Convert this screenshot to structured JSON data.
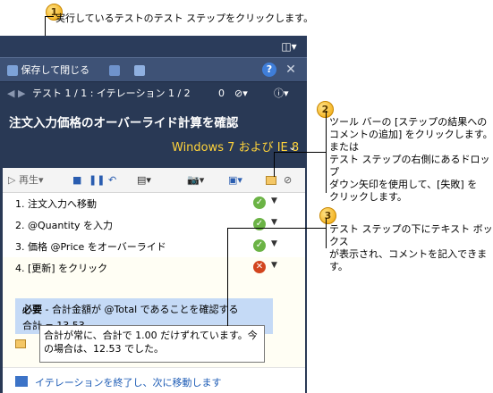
{
  "callouts": [
    {
      "num": "1",
      "text": "実行しているテストのテスト ステップをクリックします。"
    },
    {
      "num": "2",
      "lines": [
        "ツール バーの [ステップの結果への",
        "コメントの追加] をクリックします。",
        "または",
        "テスト ステップの右側にあるドロップ",
        "ダウン矢印を使用して、[失敗] を",
        "クリックします。"
      ]
    },
    {
      "num": "3",
      "lines": [
        "テスト ステップの下にテキスト ボックス",
        "が表示され、コメントを記入できます。"
      ]
    }
  ],
  "toolbar": {
    "save_close_label": "保存して閉じる",
    "help_label": "?",
    "close_label": "✕"
  },
  "nav": {
    "iteration_label": "テスト 1 / 1 : イテレーション 1 / 2",
    "attachment_count": "0"
  },
  "test": {
    "title": "注文入力価格のオーバーライド計算を確認",
    "configuration": "Windows 7 および IE 8"
  },
  "step_toolbar": {
    "play_label": "再生"
  },
  "steps": [
    {
      "label": "1. 注文入力へ移動",
      "status": "passed"
    },
    {
      "label": "2. @Quantity を入力",
      "status": "passed"
    },
    {
      "label": "3. 価格 @Price をオーバーライド",
      "status": "passed"
    },
    {
      "label": "4. [更新] をクリック",
      "status": "failed"
    }
  ],
  "expected": {
    "required_label": "必要",
    "required_text": " - 合計金額が @Total であることを確認する",
    "total_text": "合計 = 13.53"
  },
  "comment": {
    "text": "合計が常に、合計で 1.00 だけずれています。今の場合は、12.53 でした。"
  },
  "end_iteration": {
    "label": "イテレーションを終了し、次に移動します"
  },
  "colors": {
    "panel_bg": "#293955",
    "title_text": "#ffffff",
    "config_text": "#ffd33a",
    "passed": "#6bb345",
    "failed": "#d2451e",
    "expected_bg": "#c5daf6",
    "link": "#1c5bb5"
  }
}
